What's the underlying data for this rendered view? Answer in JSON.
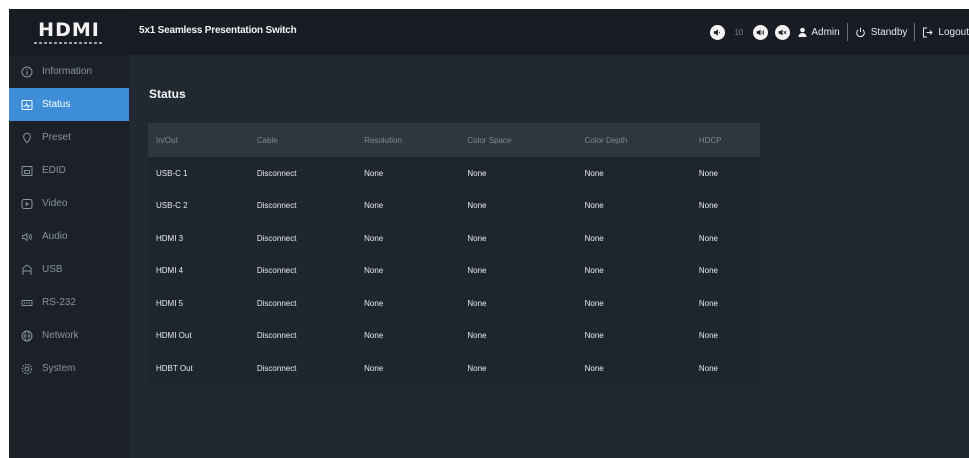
{
  "brand": {
    "logo_text": "HDMI"
  },
  "header": {
    "product_title": "5x1 Seamless Presentation Switch",
    "volume_value": "10",
    "user_label": "Admin",
    "standby_label": "Standby",
    "logout_label": "Logout"
  },
  "sidebar": {
    "items": [
      {
        "label": "Information",
        "icon": "info-icon"
      },
      {
        "label": "Status",
        "icon": "status-icon",
        "active": true
      },
      {
        "label": "Preset",
        "icon": "preset-icon"
      },
      {
        "label": "EDID",
        "icon": "edid-icon"
      },
      {
        "label": "Video",
        "icon": "video-icon"
      },
      {
        "label": "Audio",
        "icon": "audio-icon"
      },
      {
        "label": "USB",
        "icon": "usb-icon"
      },
      {
        "label": "RS-232",
        "icon": "rs232-icon"
      },
      {
        "label": "Network",
        "icon": "network-icon"
      },
      {
        "label": "System",
        "icon": "system-icon"
      }
    ]
  },
  "main": {
    "title": "Status",
    "table": {
      "columns": [
        "In/Out",
        "Cable",
        "Resolution",
        "Color Space",
        "Color Depth",
        "HDCP"
      ],
      "rows": [
        [
          "USB-C 1",
          "Disconnect",
          "None",
          "None",
          "None",
          "None"
        ],
        [
          "USB-C 2",
          "Disconnect",
          "None",
          "None",
          "None",
          "None"
        ],
        [
          "HDMI 3",
          "Disconnect",
          "None",
          "None",
          "None",
          "None"
        ],
        [
          "HDMI 4",
          "Disconnect",
          "None",
          "None",
          "None",
          "None"
        ],
        [
          "HDMI 5",
          "Disconnect",
          "None",
          "None",
          "None",
          "None"
        ],
        [
          "HDMI Out",
          "Disconnect",
          "None",
          "None",
          "None",
          "None"
        ],
        [
          "HDBT Out",
          "Disconnect",
          "None",
          "None",
          "None",
          "None"
        ]
      ]
    }
  },
  "colors": {
    "accent": "#3d8ed6",
    "sidebar_bg": "#1c2128",
    "topbar_bg": "#191d23",
    "content_bg": "#222831",
    "table_header_bg": "#2f3640"
  }
}
